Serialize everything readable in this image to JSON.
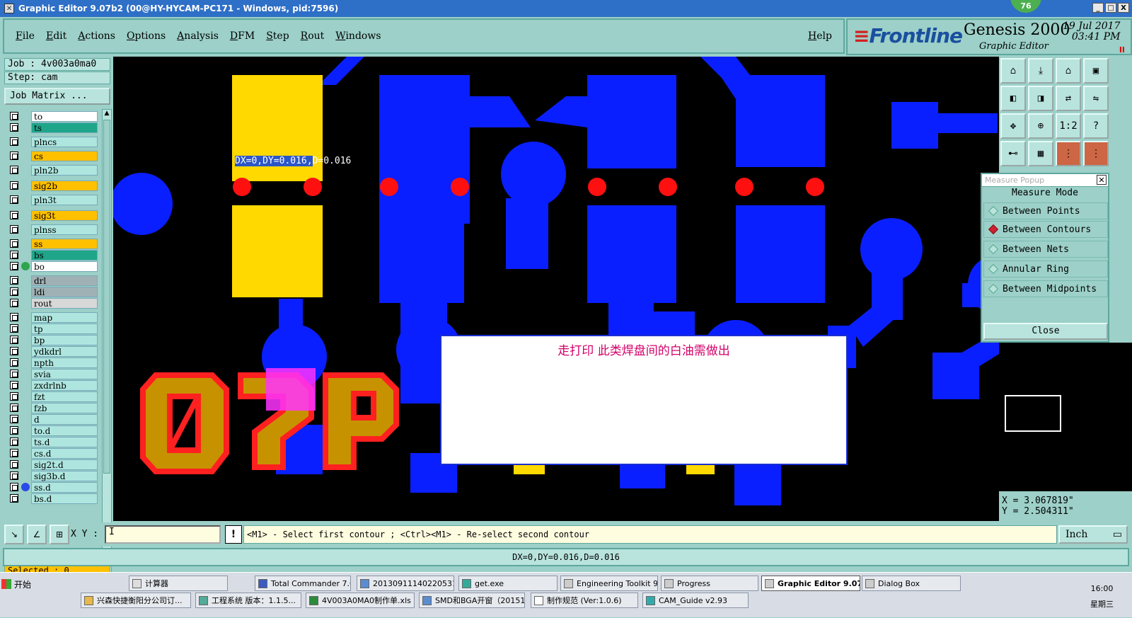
{
  "window": {
    "title": "Graphic Editor 9.07b2 (00@HY-HYCAM-PC171 - Windows, pid:7596)",
    "badge": "76",
    "buttons": [
      "_",
      "□",
      "X"
    ]
  },
  "menu": {
    "items": [
      "File",
      "Edit",
      "Actions",
      "Options",
      "Analysis",
      "DFM",
      "Step",
      "Rout",
      "Windows"
    ],
    "help": "Help"
  },
  "brand": {
    "logo": "Frontline",
    "product": "Genesis 2000",
    "subtitle": "Graphic Editor",
    "date": "19 Jul 2017",
    "time": "03:41 PM",
    "pause_glyph": "II"
  },
  "left": {
    "job": "Job : 4v003a0ma0",
    "step": "Step: cam",
    "job_matrix": "Job Matrix ...",
    "selected": "Selected : 0",
    "layers": [
      {
        "name": "to",
        "color": "#ffffff"
      },
      {
        "name": "ts",
        "color": "#1fa68a"
      },
      {
        "name": "plncs",
        "color": "#aee6df"
      },
      {
        "name": "cs",
        "color": "#ffc000"
      },
      {
        "name": "pln2b",
        "color": "#aee6df"
      },
      {
        "name": "sig2b",
        "color": "#ffc000"
      },
      {
        "name": "pln3t",
        "color": "#aee6df"
      },
      {
        "name": "sig3t",
        "color": "#ffc000"
      },
      {
        "name": "plnss",
        "color": "#aee6df"
      },
      {
        "name": "ss",
        "color": "#ffc000"
      },
      {
        "name": "bs",
        "color": "#1fa68a"
      },
      {
        "name": "bo",
        "color": "#ffffff"
      },
      {
        "name": "drl",
        "color": "#9fb1b4"
      },
      {
        "name": "ldi",
        "color": "#9fb1b4"
      },
      {
        "name": "rout",
        "color": "#d8d8d8"
      },
      {
        "name": "map",
        "color": "#aee6df"
      },
      {
        "name": "tp",
        "color": "#aee6df"
      },
      {
        "name": "bp",
        "color": "#aee6df"
      },
      {
        "name": "ydkdrl",
        "color": "#aee6df"
      },
      {
        "name": "npth",
        "color": "#aee6df"
      },
      {
        "name": "svia",
        "color": "#aee6df"
      },
      {
        "name": "zxdrlnb",
        "color": "#aee6df"
      },
      {
        "name": "fzt",
        "color": "#aee6df"
      },
      {
        "name": "fzb",
        "color": "#aee6df"
      },
      {
        "name": "d",
        "color": "#aee6df"
      },
      {
        "name": "to.d",
        "color": "#aee6df"
      },
      {
        "name": "ts.d",
        "color": "#aee6df"
      },
      {
        "name": "cs.d",
        "color": "#aee6df"
      },
      {
        "name": "sig2t.d",
        "color": "#aee6df"
      },
      {
        "name": "sig3b.d",
        "color": "#aee6df"
      },
      {
        "name": "ss.d",
        "color": "#aee6df"
      },
      {
        "name": "bs.d",
        "color": "#aee6df"
      }
    ]
  },
  "canvas": {
    "measure_highlight": "DX=0,DY=0.016,",
    "measure_rest": "D=0.016",
    "colors": {
      "copper": "#0a1fff",
      "pad": "#ffd900",
      "drill": "#ff1010",
      "silk": "#c79200",
      "silk_outline": "#ff2020",
      "highlight": "#ff33ff"
    }
  },
  "dialog": {
    "message": "走打印   此类焊盘间的白油需做出"
  },
  "measure_popup": {
    "title": "Measure Popup",
    "mode_label": "Measure Mode",
    "options": [
      "Between Points",
      "Between Contours",
      "Between Nets",
      "Annular Ring",
      "Between Midpoints"
    ],
    "selected": "Between Contours",
    "close": "Close"
  },
  "coords": {
    "x": "X = 3.067819\"",
    "y": "Y = 2.504311\""
  },
  "command": {
    "xy_label": "X Y :",
    "xy_value": "I",
    "info": "!",
    "prompt": "<M1> - Select first contour ; <Ctrl><M1> - Re-select second contour",
    "units": "Inch"
  },
  "status": "DX=0,DY=0.016,D=0.016",
  "taskbar": {
    "start": "开始",
    "row1": [
      "计算器",
      "Total Commander 7.0...",
      "20130911140220531...",
      "get.exe",
      "Engineering Toolkit 9....",
      "Progress",
      "Graphic Editor 9.07...",
      "Dialog Box"
    ],
    "row2": [
      "兴森快捷衡阳分公司订...",
      "工程系统   版本：1.1.5...",
      "4V003A0MA0制作单.xls ...",
      "SMD和BGA开窗（20151...",
      "制作规范 (Ver:1.0.6)",
      "CAM_Guide v2.93"
    ],
    "time": "16:00",
    "weekday": "星期三"
  }
}
